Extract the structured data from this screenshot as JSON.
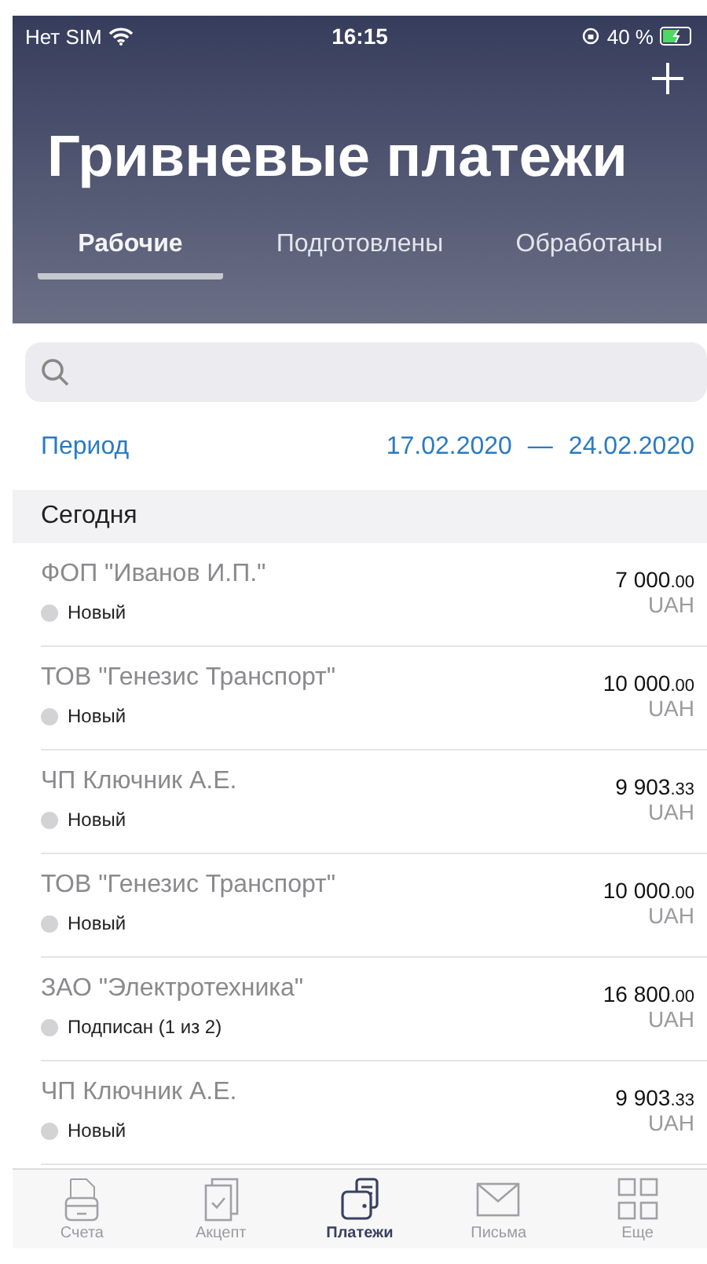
{
  "status_bar": {
    "carrier": "Нет SIM",
    "time": "16:15",
    "battery": "40 %"
  },
  "header": {
    "title": "Гривневые платежи"
  },
  "tabs": [
    {
      "label": "Рабочие",
      "selected": true
    },
    {
      "label": "Подготовлены",
      "selected": false
    },
    {
      "label": "Обработаны",
      "selected": false
    }
  ],
  "period": {
    "label": "Период",
    "from": "17.02.2020",
    "separator": "—",
    "to": "24.02.2020"
  },
  "section": {
    "title": "Сегодня"
  },
  "payments": [
    {
      "name": "ФОП \"Иванов И.П.\"",
      "status": "Новый",
      "amount": "7 000",
      "fraction": ".00",
      "currency": "UAH"
    },
    {
      "name": "ТОВ \"Генезис Транспорт\"",
      "status": "Новый",
      "amount": "10 000",
      "fraction": ".00",
      "currency": "UAH"
    },
    {
      "name": "ЧП Ключник А.Е.",
      "status": "Новый",
      "amount": "9 903",
      "fraction": ".33",
      "currency": "UAH"
    },
    {
      "name": "ТОВ \"Генезис Транспорт\"",
      "status": "Новый",
      "amount": "10 000",
      "fraction": ".00",
      "currency": "UAH"
    },
    {
      "name": "ЗАО \"Электротехника\"",
      "status": "Подписан (1 из 2)",
      "amount": "16 800",
      "fraction": ".00",
      "currency": "UAH"
    },
    {
      "name": "ЧП Ключник А.Е.",
      "status": "Новый",
      "amount": "9 903",
      "fraction": ".33",
      "currency": "UAH"
    }
  ],
  "tab_bar": [
    {
      "kind": "accounts",
      "label": "Счета",
      "selected": false
    },
    {
      "kind": "accept",
      "label": "Акцепт",
      "selected": false
    },
    {
      "kind": "payments",
      "label": "Платежи",
      "selected": true
    },
    {
      "kind": "letters",
      "label": "Письма",
      "selected": false
    },
    {
      "kind": "more",
      "label": "Еще",
      "selected": false
    }
  ]
}
